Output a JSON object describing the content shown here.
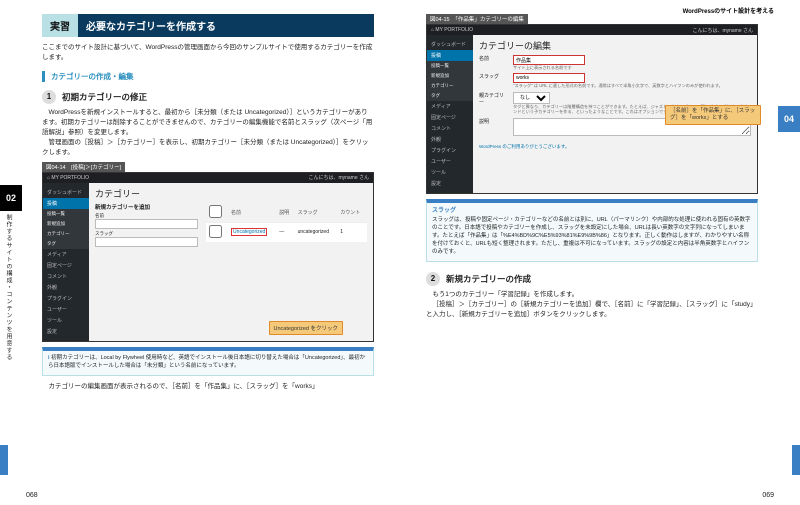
{
  "running_head": "WordPressのサイト設計を考える",
  "chapter_left": "02",
  "chapter_right": "04",
  "vtext": "制作するサイトの構成・コンテンツを用意する",
  "page_left": "068",
  "page_right": "069",
  "practice_badge": "実習",
  "practice_title": "必要なカテゴリーを作成する",
  "intro": "ここまでのサイト設計に基づいて、WordPressの管理画面から今回のサンプルサイトで使用するカテゴリーを作成します。",
  "sub_title": "カテゴリーの作成・編集",
  "step1_num": "1",
  "step1_title": "初期カテゴリーの修正",
  "step1_body1": "WordPressを新規インストールすると、最初から［未分類（または Uncategorized）］というカテゴリーがあります。初期カテゴリーは削除することができませんので、カテゴリーの編集機能で名前とスラッグ（次ページ「用語解説」参照）を変更します。",
  "step1_body2": "管理画面の［投稿］＞［カテゴリー］を表示し、初期カテゴリー［未分類（または Uncategorized）］をクリックします。",
  "shot_a_label": "図04-14　[投稿]＞[カテゴリー]",
  "shot_b_label": "図04-15　「作品集」カテゴリーの編集",
  "wp": {
    "topbar_left": "⌂ MY PORTFOLIO",
    "topbar_right": "こんにちは、myname さん",
    "menu": [
      "ダッシュボード",
      "投稿",
      "メディア",
      "固定ページ",
      "コメント",
      "外観",
      "プラグイン",
      "ユーザー",
      "ツール",
      "設定"
    ],
    "menu_posts": "投稿",
    "submenu": [
      "投稿一覧",
      "新規追加",
      "カテゴリー",
      "タグ"
    ],
    "cat_h": "カテゴリー",
    "cat_edit_h": "カテゴリーの編集",
    "new_cat_label": "新規カテゴリーを追加",
    "form": {
      "name": "名前",
      "name_val": "作品集",
      "slug": "スラッグ",
      "slug_val": "works",
      "parent": "親カテゴリー",
      "parent_val": "なし",
      "desc": "説明"
    },
    "table": {
      "col1": "名前",
      "col2": "説明",
      "col3": "スラッグ",
      "col4": "カウント",
      "row1_name": "Uncategorized",
      "row1_slug": "uncategorized",
      "row1_count": "1"
    },
    "callout_a": "Uncategorized をクリック",
    "callout_b": "［名前］を「作品集」に、［スラッグ］を「works」とする",
    "hint_name": "サイト上に表示される名前です",
    "hint_slug": "\"スラッグ\" は URL に適した形式の名前です。通常はすべて半角小文字で、英数字とハイフンのみが使われます。",
    "hint_parent": "タグと異なり、カテゴリーは階層構造を持つことができます。たとえば、ジャズというカテゴリーの下にビバップやビッグバンドという子カテゴリーを作る、といったようなことです。これはオプションです。",
    "footer": "WordPress のご利用ありがとうございます。"
  },
  "note_a": "初期カテゴリーは、Local by Flywheel 使用時など、英語でインストール後日本語に切り替えた場合は「Uncategorized」、最初から日本語版でインストールした場合は「未分類」という名前になっています。",
  "after_shot_a": "カテゴリーの編集画面が表示されるので、［名前］を「作品集」に、［スラッグ］を「works」",
  "slug_box_title": "スラッグ",
  "slug_box_body": "スラッグは、投稿や固定ページ・カテゴリーなどの名前とは別に、URL（パーマリンク）や内部的な処理に使われる固有の英数字のことです。日本語で投稿やカテゴリーを作成し、スラッグを未設定にした場合、URLは長い英数字の文字列になってしまいます。たとえば「作品集」は「%E4%BD%9C%E5%93%81%E9%9B%86」となります。正しく動作はしますが、わかりやすい名称を付けておくと、URLも短く整理されます。ただし、重複は不可になっています。スラッグの設定と内容は半角英数字とハイフンのみです。",
  "step2_num": "2",
  "step2_title": "新規カテゴリーの作成",
  "step2_body1": "もう1つのカテゴリー「学習記録」を作成します。",
  "step2_body2": "［投稿］＞［カテゴリー］の［新規カテゴリーを追加］欄で、［名前］に「学習記録」、［スラッグ］に「study」と入力し、［新規カテゴリーを追加］ボタンをクリックします。"
}
